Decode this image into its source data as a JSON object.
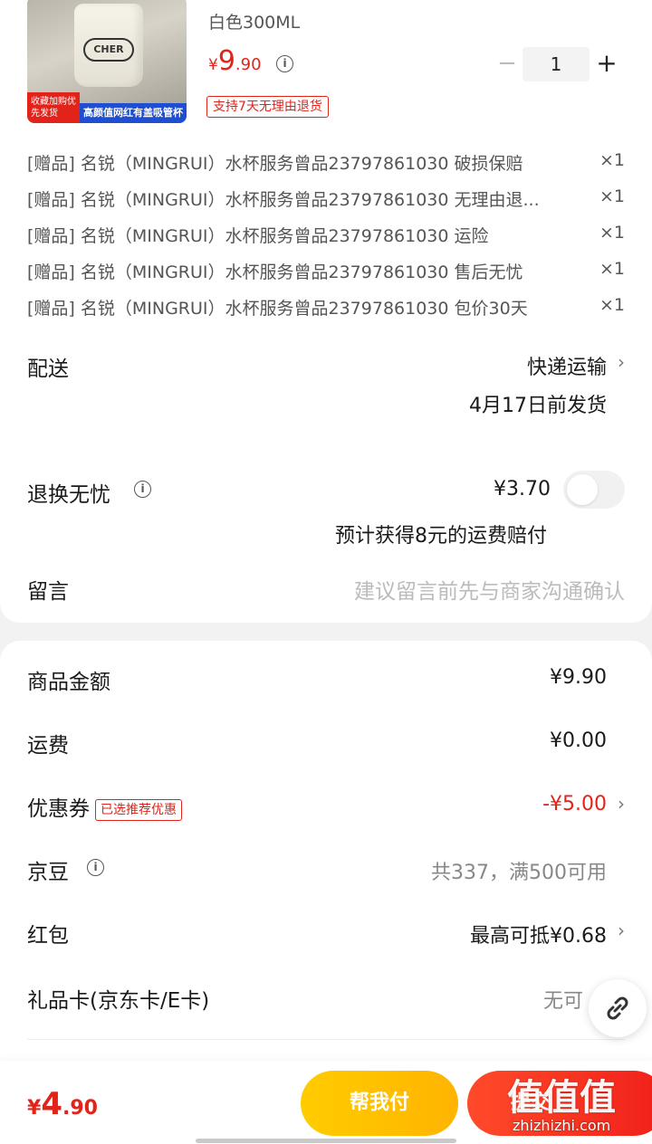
{
  "product": {
    "variant": "白色300ML",
    "price_symbol": "¥",
    "price_int": "9",
    "price_dec": ".90",
    "quantity": "1",
    "return_badge": "支持7天无理由退货",
    "img_tag_left": "收藏加购优先发货",
    "img_tag_right": "高颜值网红有盖吸管杯",
    "cup_logo": "CHER"
  },
  "gifts": [
    {
      "text": "[赠品] 名锐（MINGRUI）水杯服务曾品23797861030 破损保赔",
      "qty": "×1"
    },
    {
      "text": "[赠品] 名锐（MINGRUI）水杯服务曾品23797861030 无理由退...",
      "qty": "×1"
    },
    {
      "text": "[赠品] 名锐（MINGRUI）水杯服务曾品23797861030 运险",
      "qty": "×1"
    },
    {
      "text": "[赠品] 名锐（MINGRUI）水杯服务曾品23797861030 售后无忧",
      "qty": "×1"
    },
    {
      "text": "[赠品] 名锐（MINGRUI）水杯服务曾品23797861030 包价30天",
      "qty": "×1"
    }
  ],
  "delivery": {
    "label": "配送",
    "method": "快递运输",
    "ship_date": "4月17日前发货"
  },
  "return_worry_free": {
    "label": "退换无忧",
    "price": "¥3.70",
    "note": "预计获得8元的运费赔付",
    "enabled": false
  },
  "message": {
    "label": "留言",
    "placeholder": "建议留言前先与商家沟通确认"
  },
  "fees": {
    "goods_label": "商品金额",
    "goods_value": "¥9.90",
    "shipping_label": "运费",
    "shipping_value": "¥0.00",
    "coupon_label": "优惠券",
    "coupon_badge": "已选推荐优惠",
    "coupon_value": "-¥5.00",
    "jingdou_label": "京豆",
    "jingdou_value": "共337，满500可用",
    "redpacket_label": "红包",
    "redpacket_value": "最高可抵¥0.68",
    "giftcard_label": "礼品卡(京东卡/E卡)",
    "giftcard_value": "无可"
  },
  "bottom": {
    "total_symbol": "¥",
    "total_int": "4",
    "total_dec": ".90",
    "help_pay": "帮我付",
    "submit": "提交"
  },
  "watermark": {
    "text": "值值值",
    "url": "zhizhizhi.com"
  },
  "colors": {
    "accent_red": "#e2231a",
    "help_yellow": "#ffcc00",
    "page_bg": "#f2f2f2"
  },
  "icons": {
    "info": "info-icon",
    "chevron": "chevron-right-icon",
    "link": "link-icon"
  }
}
